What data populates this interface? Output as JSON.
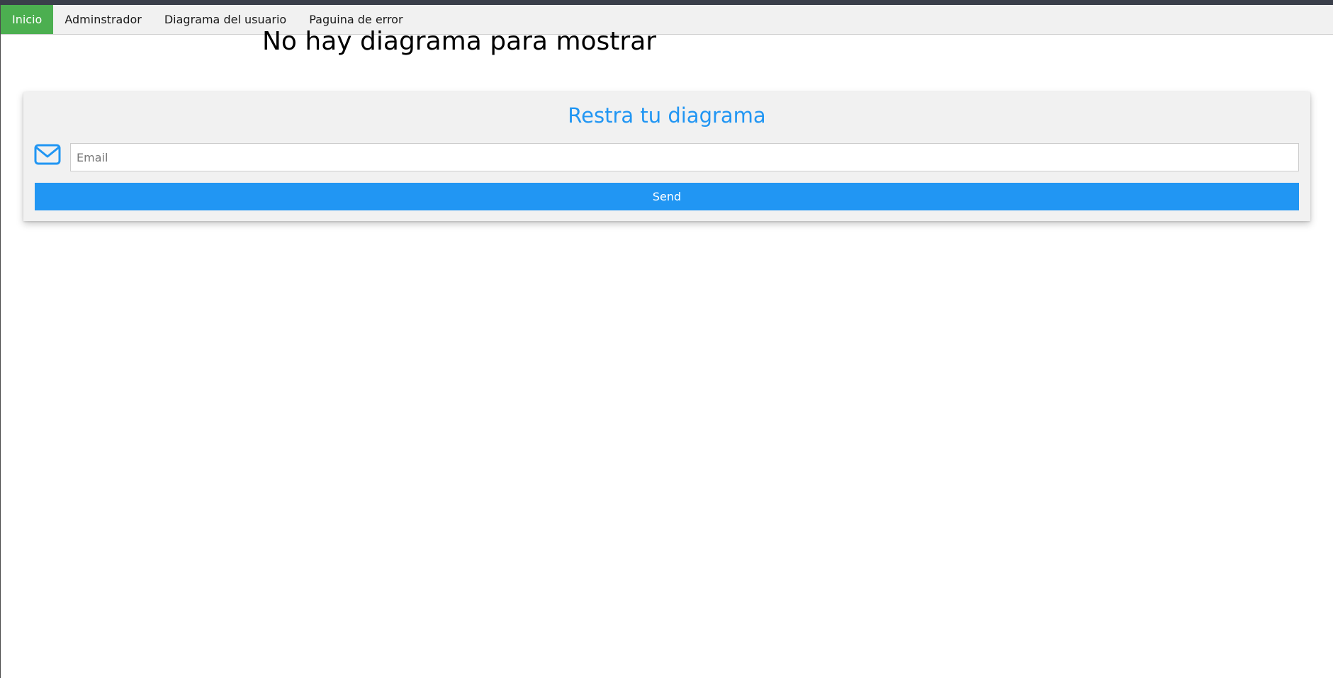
{
  "nav": {
    "items": [
      {
        "label": "Inicio",
        "active": true
      },
      {
        "label": "Adminstrador",
        "active": false
      },
      {
        "label": "Diagrama del usuario",
        "active": false
      },
      {
        "label": "Paguina de error",
        "active": false
      }
    ]
  },
  "main": {
    "headline": "No hay diagrama para mostrar"
  },
  "form": {
    "title": "Restra tu diagrama",
    "email_placeholder": "Email",
    "email_value": "",
    "icon": "envelope-icon",
    "send_label": "Send"
  },
  "colors": {
    "active_nav": "#4caf50",
    "accent": "#2196f3",
    "navbar_bg": "#f1f1f1",
    "card_bg": "#f1f1f1"
  }
}
